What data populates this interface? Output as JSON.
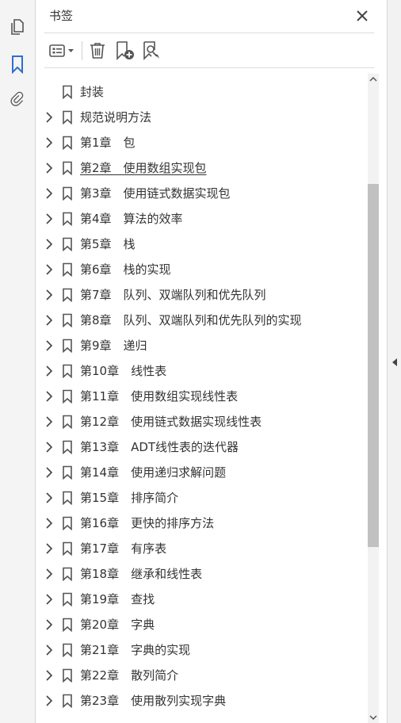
{
  "panel": {
    "title": "书签"
  },
  "toolbar": {
    "options": "options-icon",
    "delete": "trash-icon",
    "new_bookmark": "new-bookmark-icon",
    "find_bookmark": "find-bookmark-icon"
  },
  "leftnav": [
    "pages-icon",
    "bookmark-icon",
    "paperclip-icon"
  ],
  "accent_color": "#2d6fd0",
  "bookmarks": [
    {
      "label": "封装",
      "expandable": false
    },
    {
      "label": "规范说明方法",
      "expandable": true
    },
    {
      "label": "第1章　包",
      "expandable": true
    },
    {
      "label": "第2章　使用数组实现包",
      "expandable": true,
      "active": true
    },
    {
      "label": "第3章　使用链式数据实现包",
      "expandable": true
    },
    {
      "label": "第4章　算法的效率",
      "expandable": true
    },
    {
      "label": "第5章　栈",
      "expandable": true
    },
    {
      "label": "第6章　栈的实现",
      "expandable": true
    },
    {
      "label": "第7章　队列、双端队列和优先队列",
      "expandable": true
    },
    {
      "label": "第8章　队列、双端队列和优先队列的实现",
      "expandable": true
    },
    {
      "label": "第9章　递归",
      "expandable": true
    },
    {
      "label": "第10章　线性表",
      "expandable": true
    },
    {
      "label": "第11章　使用数组实现线性表",
      "expandable": true
    },
    {
      "label": "第12章　使用链式数据实现线性表",
      "expandable": true
    },
    {
      "label": "第13章　ADT线性表的迭代器",
      "expandable": true
    },
    {
      "label": "第14章　使用递归求解问题",
      "expandable": true
    },
    {
      "label": "第15章　排序简介",
      "expandable": true
    },
    {
      "label": "第16章　更快的排序方法",
      "expandable": true
    },
    {
      "label": "第17章　有序表",
      "expandable": true
    },
    {
      "label": "第18章　继承和线性表",
      "expandable": true
    },
    {
      "label": "第19章　查找",
      "expandable": true
    },
    {
      "label": "第20章　字典",
      "expandable": true
    },
    {
      "label": "第21章　字典的实现",
      "expandable": true
    },
    {
      "label": "第22章　散列简介",
      "expandable": true
    },
    {
      "label": "第23章　使用散列实现字典",
      "expandable": true
    }
  ],
  "scrollbar": {
    "position": 0.18,
    "visible_fraction": 0.56
  }
}
